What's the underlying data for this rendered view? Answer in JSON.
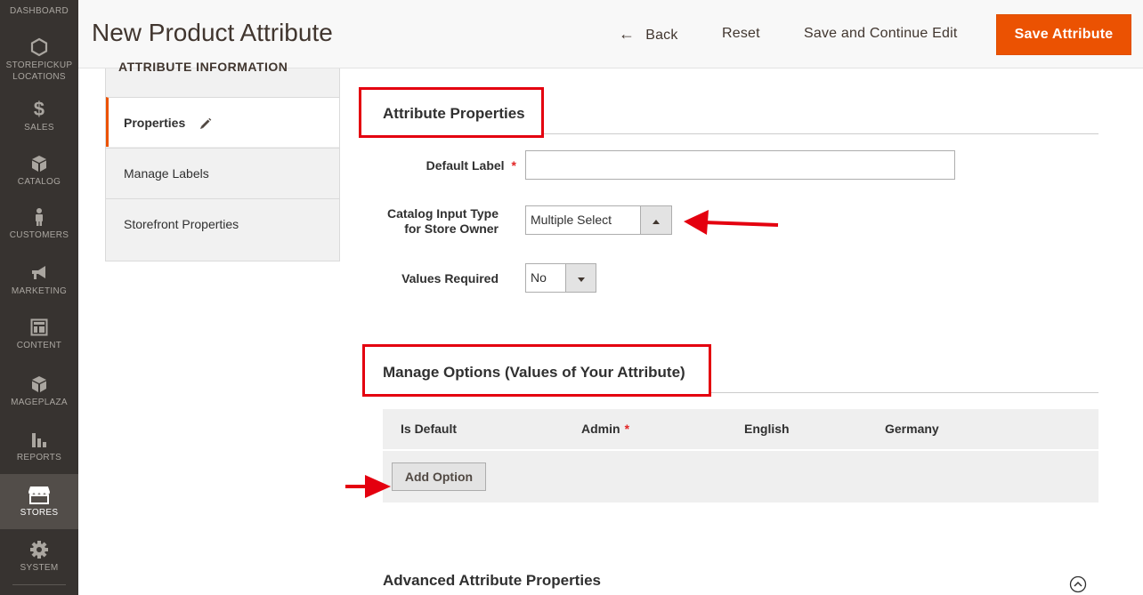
{
  "nav": {
    "items": [
      {
        "label": "Dashboard",
        "icon": "dashboard-icon"
      },
      {
        "label": "Storepickup Locations",
        "icon": "hexagon-icon"
      },
      {
        "label": "Sales",
        "icon": "dollar-icon"
      },
      {
        "label": "Catalog",
        "icon": "box-icon"
      },
      {
        "label": "Customers",
        "icon": "person-icon"
      },
      {
        "label": "Marketing",
        "icon": "megaphone-icon"
      },
      {
        "label": "Content",
        "icon": "layout-icon"
      },
      {
        "label": "Mageplaza",
        "icon": "box-icon"
      },
      {
        "label": "Reports",
        "icon": "bar-chart-icon"
      },
      {
        "label": "Stores",
        "icon": "store-icon",
        "active": true
      },
      {
        "label": "System",
        "icon": "gear-icon"
      }
    ]
  },
  "header": {
    "title": "New Product Attribute",
    "back_label": "Back",
    "reset_label": "Reset",
    "continue_label": "Save and Continue Edit",
    "save_label": "Save Attribute"
  },
  "tabs": {
    "heading": "Attribute Information",
    "items": [
      {
        "label": "Properties",
        "active": true
      },
      {
        "label": "Manage Labels"
      },
      {
        "label": "Storefront Properties"
      }
    ]
  },
  "attribute_properties": {
    "title": "Attribute Properties",
    "default_label": {
      "label": "Default Label",
      "value": "",
      "required": true
    },
    "input_type": {
      "label_line1": "Catalog Input Type",
      "label_line2": "for Store Owner",
      "value": "Multiple Select"
    },
    "values_required": {
      "label": "Values Required",
      "value": "No"
    }
  },
  "manage_options": {
    "title": "Manage Options (Values of Your Attribute)",
    "columns": [
      "Is Default",
      "Admin",
      "English",
      "Germany"
    ],
    "add_option_label": "Add Option"
  },
  "advanced": {
    "title": "Advanced Attribute Properties"
  },
  "colors": {
    "accent": "#eb5202",
    "annotation_red": "#e4000f",
    "nav_bg": "#373330"
  }
}
